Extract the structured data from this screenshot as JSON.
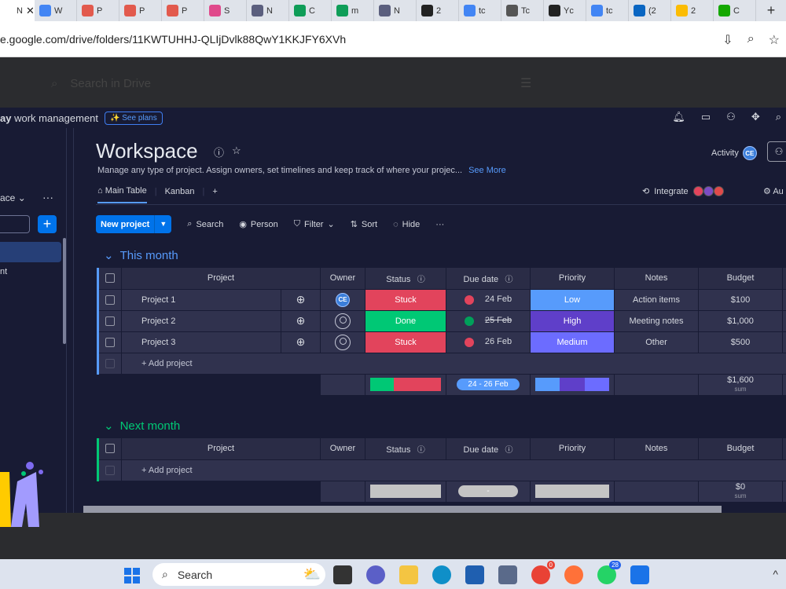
{
  "browser": {
    "tabs": [
      {
        "label": "N",
        "icon": "tab-active-icon",
        "color": "#ffffff",
        "active": true
      },
      {
        "label": "W",
        "icon": "docs-icon",
        "color": "#4285f4"
      },
      {
        "label": "P",
        "icon": "slides-icon",
        "color": "#e25a4d"
      },
      {
        "label": "P",
        "icon": "slides-icon",
        "color": "#e25a4d"
      },
      {
        "label": "P",
        "icon": "slides-icon",
        "color": "#e25a4d"
      },
      {
        "label": "S",
        "icon": "shield-icon",
        "color": "#e04a8c"
      },
      {
        "label": "N",
        "icon": "monday-icon",
        "color": "#5b5f7e"
      },
      {
        "label": "C",
        "icon": "sheets-plus-icon",
        "color": "#0f9d58"
      },
      {
        "label": "m",
        "icon": "sheets-plus-icon",
        "color": "#0f9d58"
      },
      {
        "label": "N",
        "icon": "monday-icon",
        "color": "#5b5f7e"
      },
      {
        "label": "2",
        "icon": "f-icon",
        "color": "#222222"
      },
      {
        "label": "tc",
        "icon": "google-icon",
        "color": "#4285f4"
      },
      {
        "label": "Tc",
        "icon": "globe-icon",
        "color": "#555555"
      },
      {
        "label": "Yc",
        "icon": "person-icon",
        "color": "#222222"
      },
      {
        "label": "tc",
        "icon": "google-icon",
        "color": "#4285f4"
      },
      {
        "label": "(2",
        "icon": "linkedin-icon",
        "color": "#0a66c2"
      },
      {
        "label": "2",
        "icon": "drive-icon",
        "color": "#fbbc04"
      },
      {
        "label": "C",
        "icon": "upwork-icon",
        "color": "#14a800"
      }
    ],
    "active_tab_close": "✕",
    "new_tab": "+",
    "url": "e.google.com/drive/folders/11KWTUHHJ-QLIjDvlk88QwY1KKJFY6XVh"
  },
  "drive": {
    "search_placeholder": "Search in Drive"
  },
  "app": {
    "brand_bold": "ay",
    "brand_rest": " work management",
    "see_plans": "✨ See plans",
    "sidebar": {
      "workspace_label": "ace",
      "workspace_chevron": "⌄",
      "dots": "···",
      "plus": "+",
      "item": "nt"
    },
    "workspace": {
      "title": "Workspace",
      "description": "Manage any type of project. Assign owners, set timelines and keep track of where your projec...",
      "see_more": "See More",
      "activity_label": "Activity",
      "activity_avatar": "CE",
      "tabs": [
        "Main Table",
        "Kanban"
      ],
      "add_tab": "+",
      "integrate_label": "Integrate",
      "automate_label": "Au"
    },
    "toolbar": {
      "new_project": "New project",
      "search": "Search",
      "person": "Person",
      "filter": "Filter",
      "sort": "Sort",
      "hide": "Hide",
      "more": "···"
    },
    "columns": [
      "Project",
      "Owner",
      "Status",
      "Due date",
      "Priority",
      "Notes",
      "Budget"
    ],
    "groups": [
      {
        "title": "This month",
        "color": "#579bfc",
        "rows": [
          {
            "project": "Project 1",
            "owner": "CE",
            "status": "Stuck",
            "due": "24 Feb",
            "due_state": "overdue",
            "priority": "Low",
            "notes": "Action items",
            "budget": "$100"
          },
          {
            "project": "Project 2",
            "owner": "",
            "status": "Done",
            "due": "25 Feb",
            "due_state": "done",
            "priority": "High",
            "notes": "Meeting notes",
            "budget": "$1,000"
          },
          {
            "project": "Project 3",
            "owner": "",
            "status": "Stuck",
            "due": "26 Feb",
            "due_state": "overdue",
            "priority": "Medium",
            "notes": "Other",
            "budget": "$500"
          }
        ],
        "add_label": "+ Add project",
        "summary": {
          "timeline": "24 - 26 Feb",
          "budget": "$1,600",
          "budget_label": "sum"
        }
      },
      {
        "title": "Next month",
        "color": "#00c875",
        "rows": [],
        "add_label": "+ Add project",
        "summary": {
          "timeline": "-",
          "budget": "$0",
          "budget_label": "sum"
        }
      }
    ]
  },
  "taskbar": {
    "search": "Search",
    "chrome_badge": "0",
    "whatsapp_badge": "28",
    "tray": "^"
  }
}
